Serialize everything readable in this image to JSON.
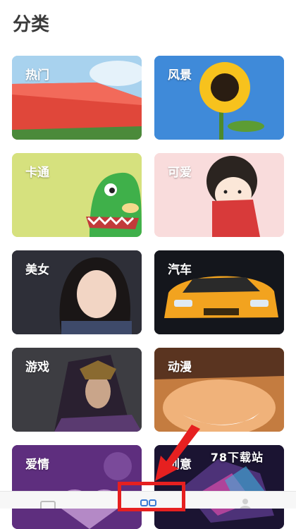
{
  "page": {
    "title": "分类"
  },
  "categories": [
    {
      "label": "热门"
    },
    {
      "label": "风景"
    },
    {
      "label": "卡通"
    },
    {
      "label": "可爱"
    },
    {
      "label": "美女"
    },
    {
      "label": "汽车"
    },
    {
      "label": "游戏"
    },
    {
      "label": "动漫"
    },
    {
      "label": "爱情"
    },
    {
      "label": "创意"
    }
  ],
  "overlay": {
    "watermark": "78下载站"
  },
  "colors": {
    "highlight": "#e62020",
    "title": "#3a3a3a"
  },
  "bottom_nav": {
    "items": [
      {
        "icon": "home-icon"
      },
      {
        "icon": "category-icon",
        "active": true
      },
      {
        "icon": "profile-icon"
      }
    ]
  }
}
